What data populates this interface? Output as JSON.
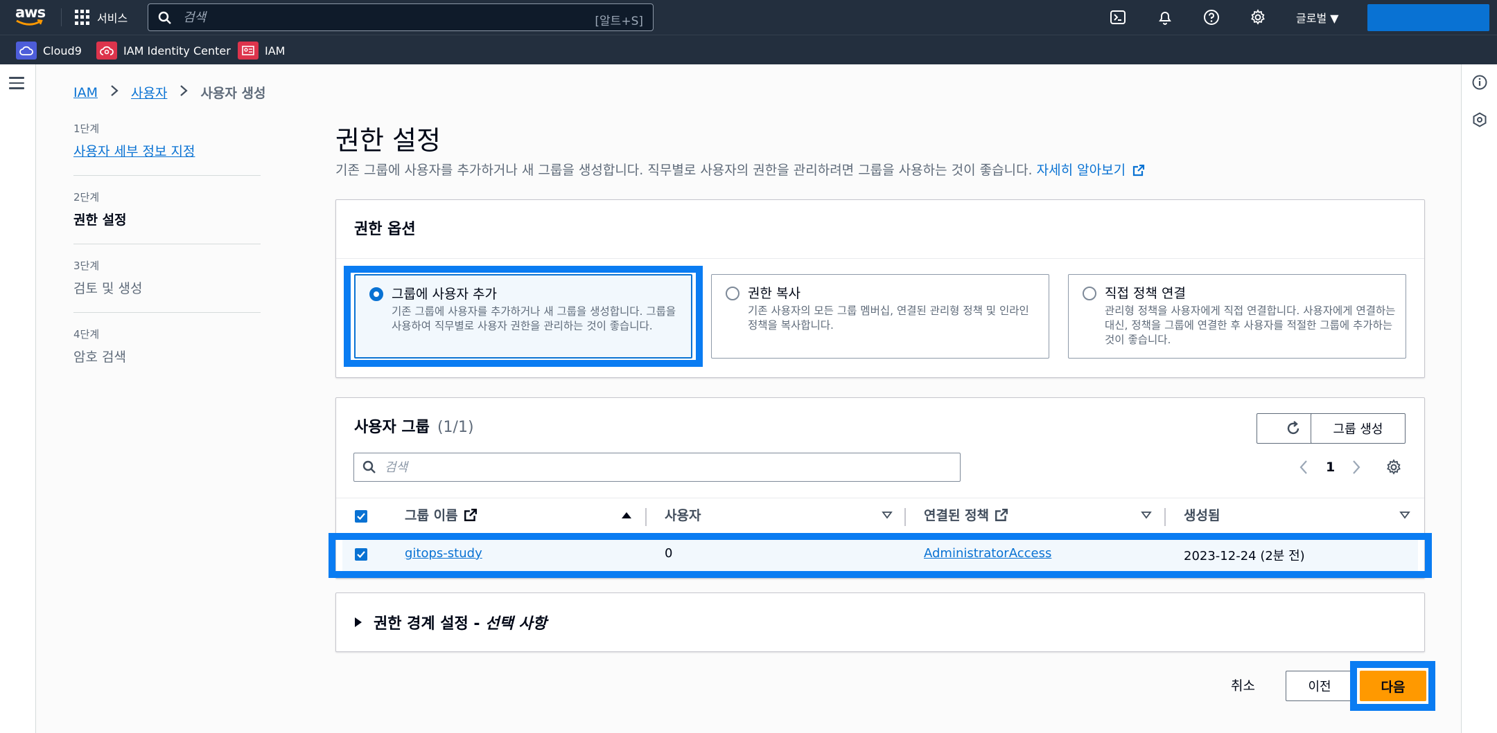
{
  "topnav": {
    "services_label": "서비스",
    "search_placeholder": "검색",
    "search_shortcut": "[알트+S]",
    "region_label": "글로벌 ▼"
  },
  "favorites": [
    "Cloud9",
    "IAM Identity Center",
    "IAM"
  ],
  "breadcrumb": [
    "IAM",
    "사용자",
    "사용자 생성"
  ],
  "steps": [
    {
      "num": "1단계",
      "name": "사용자 세부 정보 지정"
    },
    {
      "num": "2단계",
      "name": "권한 설정"
    },
    {
      "num": "3단계",
      "name": "검토 및 생성"
    },
    {
      "num": "4단계",
      "name": "암호 검색"
    }
  ],
  "page": {
    "title": "권한 설정",
    "description": "기존 그룹에 사용자를 추가하거나 새 그룹을 생성합니다. 직무별로 사용자의 권한을 관리하려면 그룹을 사용하는 것이 좋습니다.",
    "learn_more": "자세히 알아보기"
  },
  "permission_options": {
    "title": "권한 옵션",
    "options": [
      {
        "title": "그룹에 사용자 추가",
        "desc": "기존 그룹에 사용자를 추가하거나 새 그룹을 생성합니다. 그룹을 사용하여 직무별로 사용자 권한을 관리하는 것이 좋습니다.",
        "selected": true
      },
      {
        "title": "권한 복사",
        "desc": "기존 사용자의 모든 그룹 멤버십, 연결된 관리형 정책 및 인라인 정책을 복사합니다.",
        "selected": false
      },
      {
        "title": "직접 정책 연결",
        "desc": "관리형 정책을 사용자에게 직접 연결합니다. 사용자에게 연결하는 대신, 정책을 그룹에 연결한 후 사용자를 적절한 그룹에 추가하는 것이 좋습니다.",
        "selected": false
      }
    ]
  },
  "user_groups": {
    "title": "사용자 그룹",
    "count": "(1/1)",
    "create_button": "그룹 생성",
    "search_placeholder": "검색",
    "page_number": "1",
    "columns": [
      "그룹 이름",
      "사용자",
      "연결된 정책",
      "생성됨"
    ],
    "rows": [
      {
        "name": "gitops-study",
        "users": "0",
        "policy": "AdministratorAccess",
        "created": "2023-12-24 (2분 전)",
        "checked": true
      }
    ]
  },
  "boundary": {
    "prefix": "권한 경계 설정 - ",
    "optional": "선택 사항"
  },
  "footer": {
    "cancel": "취소",
    "prev": "이전",
    "next": "다음"
  },
  "colors": {
    "accent": "#0972d3",
    "primary_button": "#ff9900",
    "nav_bg": "#232f3e",
    "highlight": "#0a7cf2"
  }
}
